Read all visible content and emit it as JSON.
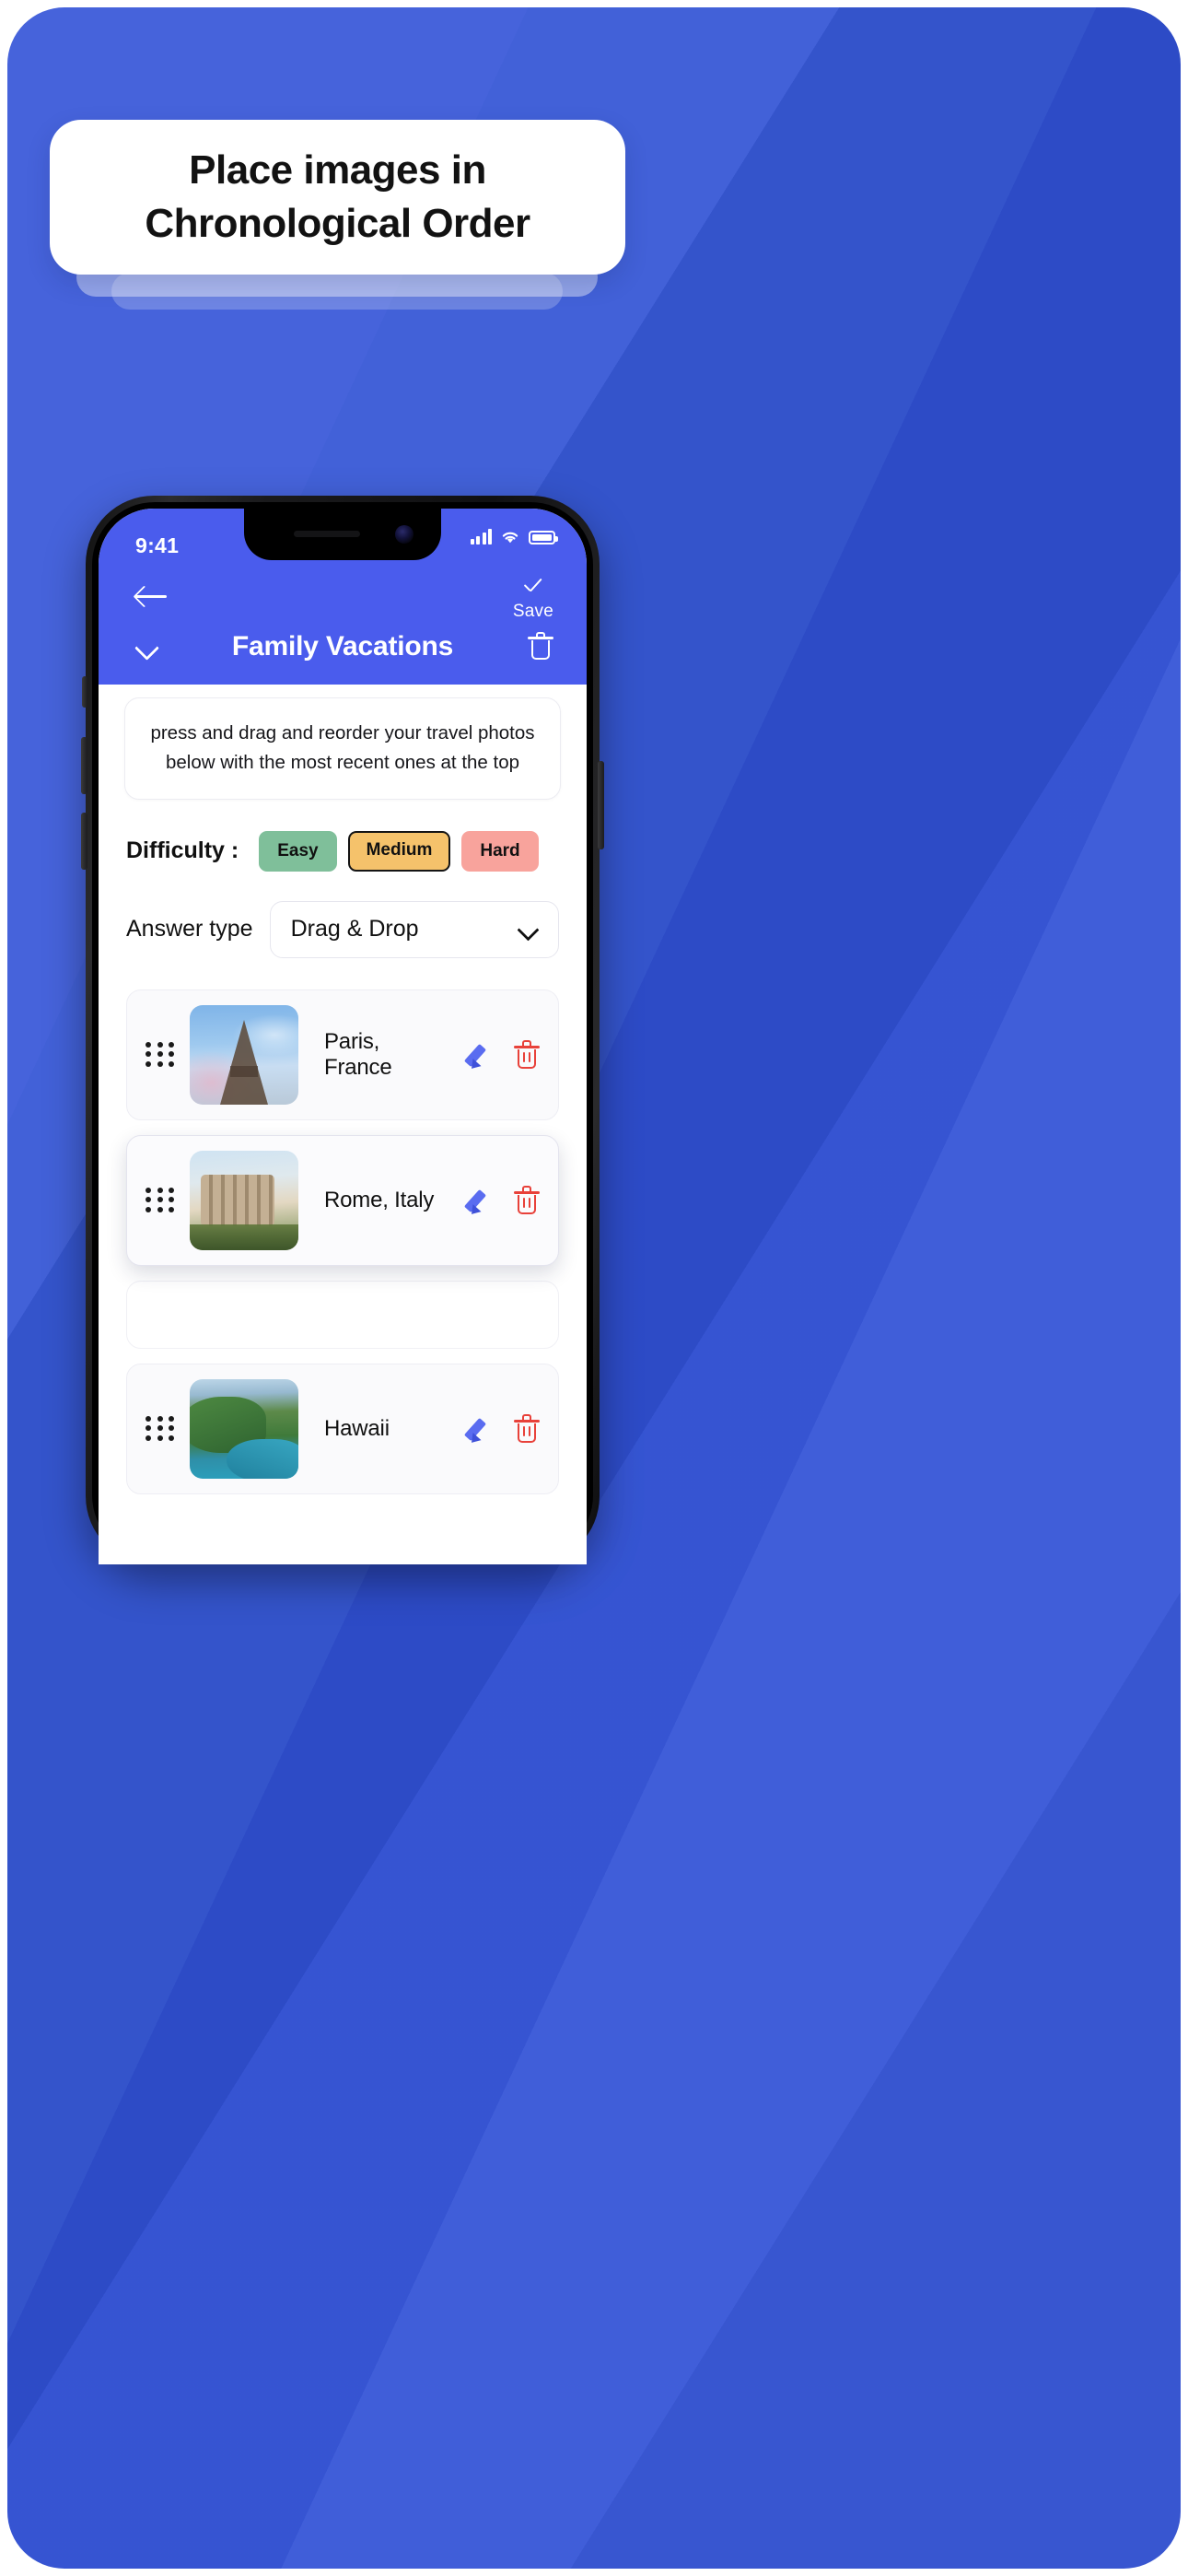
{
  "promo": {
    "title_line1": "Place images in",
    "title_line2": "Chronological Order",
    "background_color": "#3b5ad9",
    "card_color": "#ffffff"
  },
  "phone": {
    "statusbar": {
      "time": "9:41",
      "signal_icon": "cellular-signal-icon",
      "wifi_icon": "wifi-icon",
      "battery_icon": "battery-icon"
    }
  },
  "app": {
    "header": {
      "back_icon": "back-arrow-icon",
      "save_icon": "check-icon",
      "save_label": "Save",
      "collapse_icon": "chevron-down-icon",
      "deck_title": "Family Vacations",
      "delete_icon": "trash-icon",
      "accent_color": "#4a5ced"
    },
    "instructions": "press and drag and reorder your travel photos below with the most recent ones at the top",
    "difficulty": {
      "label": "Difficulty :",
      "options": [
        {
          "label": "Easy",
          "color": "#7fbf9a",
          "selected": false
        },
        {
          "label": "Medium",
          "color": "#f5c26b",
          "selected": true
        },
        {
          "label": "Hard",
          "color": "#f8a39c",
          "selected": false
        }
      ]
    },
    "answer_type": {
      "label": "Answer type",
      "value": "Drag & Drop",
      "caret_icon": "chevron-down-icon"
    },
    "photo_items": [
      {
        "label": "Paris, France",
        "drag_handle_icon": "drag-handle-icon",
        "thumb": "eiffel-tower-photo",
        "edit_icon": "pencil-icon",
        "delete_icon": "trash-icon",
        "dragging": false
      },
      {
        "label": "Rome, Italy",
        "drag_handle_icon": "drag-handle-icon",
        "thumb": "colosseum-photo",
        "edit_icon": "pencil-icon",
        "delete_icon": "trash-icon",
        "dragging": true
      },
      {
        "label": "Hawaii",
        "drag_handle_icon": "drag-handle-icon",
        "thumb": "hawaii-coast-photo",
        "edit_icon": "pencil-icon",
        "delete_icon": "trash-icon",
        "dragging": false
      }
    ]
  }
}
